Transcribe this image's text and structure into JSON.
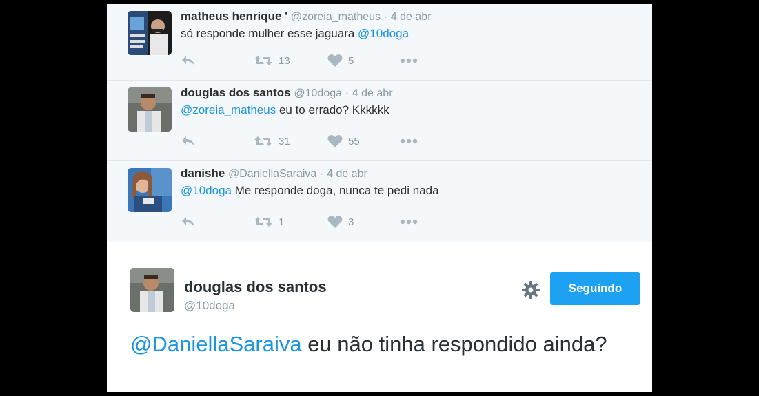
{
  "replies": [
    {
      "name": "matheus henrique '",
      "handle": "@zoreia_matheus",
      "separator": "·",
      "date": "4 de abr",
      "text_plain": "só responde mulher esse jaguara ",
      "text_mention": "@10doga",
      "retweets": "13",
      "likes": "5"
    },
    {
      "name": "douglas dos santos",
      "handle": "@10doga",
      "separator": "·",
      "date": "4 de abr",
      "text_mention": "@zoreia_matheus",
      "text_plain": " eu to errado? Kkkkkk",
      "retweets": "31",
      "likes": "55"
    },
    {
      "name": "danishe",
      "handle": "@DaniellaSaraiva",
      "separator": "·",
      "date": "4 de abr",
      "text_mention": "@10doga",
      "text_plain": " Me responde doga, nunca te pedi nada",
      "retweets": "1",
      "likes": "3"
    }
  ],
  "main_tweet": {
    "name": "douglas dos santos",
    "handle": "@10doga",
    "follow_label": "Seguindo",
    "text_mention": "@DaniellaSaraiva",
    "text_plain": " eu não tinha respondido ainda?"
  },
  "colors": {
    "accent": "#1da1f2",
    "mention": "#1b95e0",
    "muted": "#8899a6",
    "icon": "#aab8c2"
  },
  "icons": [
    "reply-icon",
    "retweet-icon",
    "heart-icon",
    "more-icon",
    "gear-icon"
  ]
}
